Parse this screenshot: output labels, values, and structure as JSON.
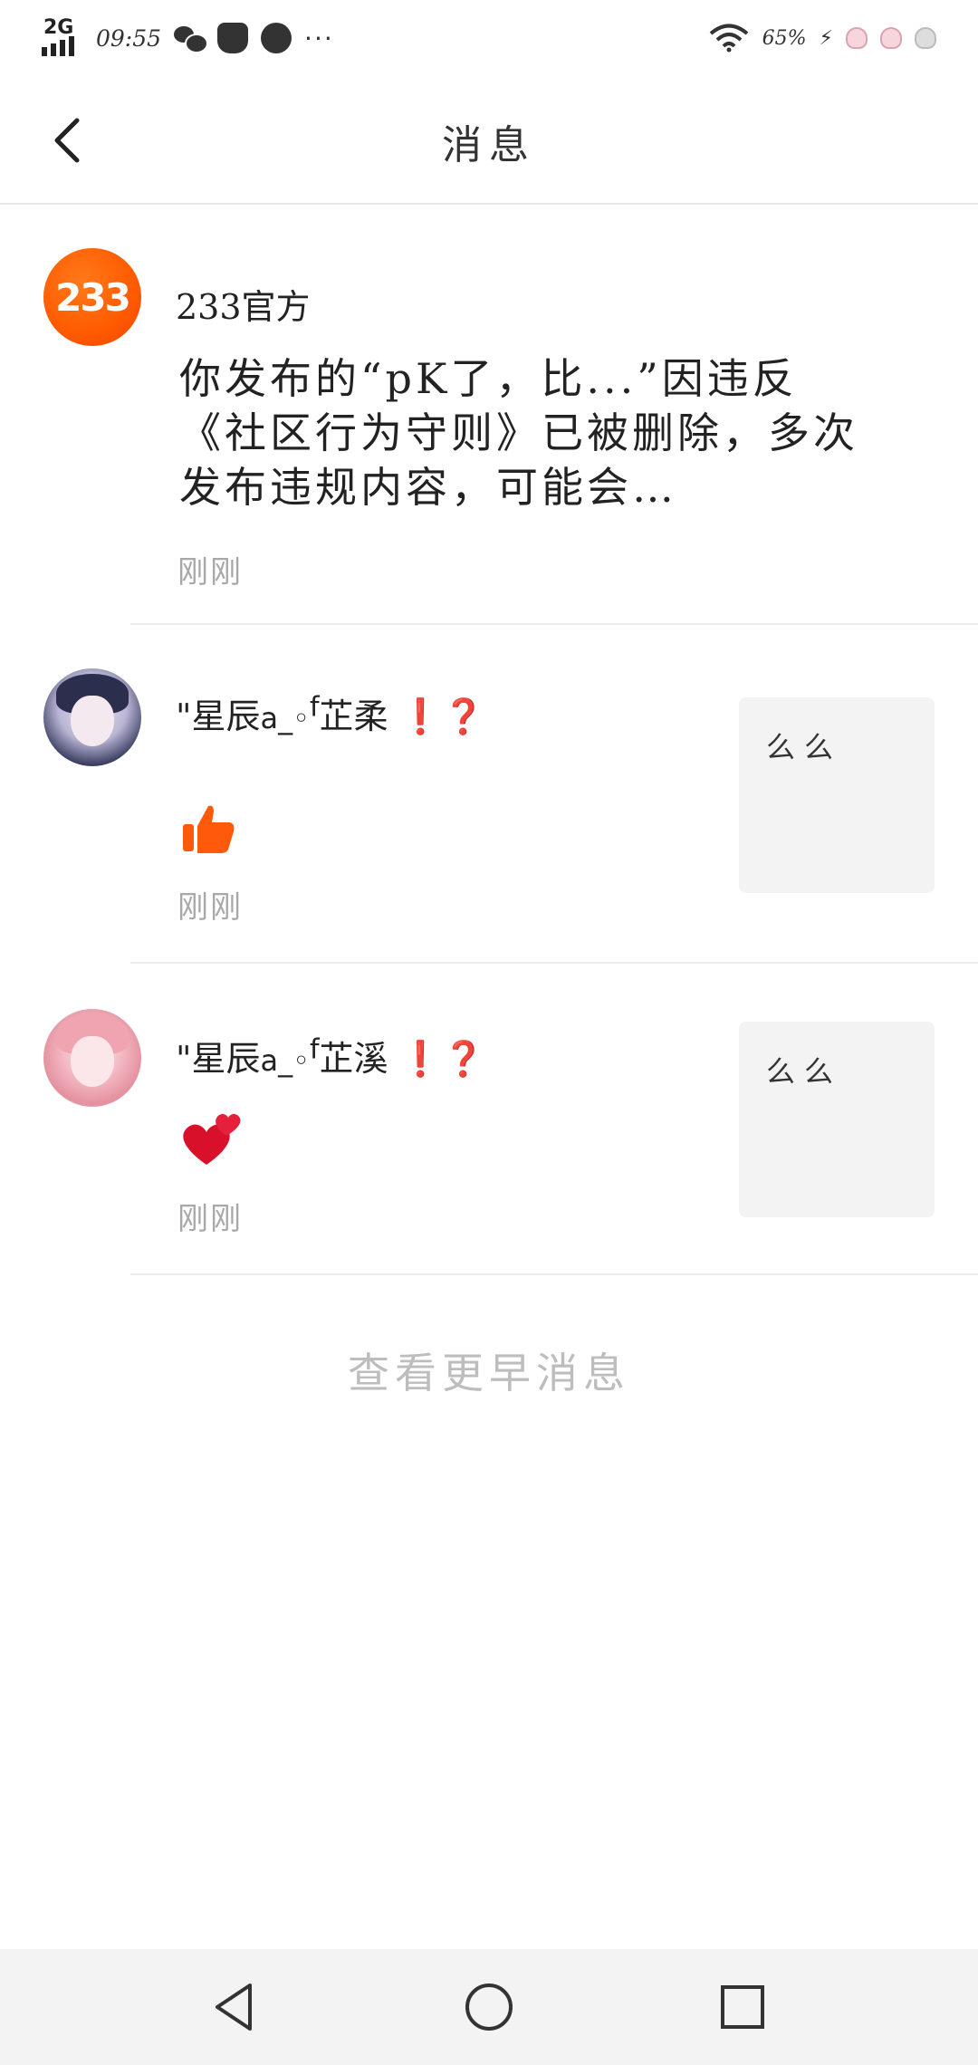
{
  "status_bar": {
    "network": "2G",
    "time": "09:55",
    "more": "···",
    "battery": "65%"
  },
  "header": {
    "title": "消息"
  },
  "messages": [
    {
      "sender": "233官方",
      "avatar_text": "233",
      "body": "你发布的“pK了，比...”因违反《社区行为守则》已被删除，多次发布违规内容，可能会…",
      "time": "刚刚"
    },
    {
      "sender_prefix": "\"星辰",
      "sender_mid": "a_◦",
      "sender_f": "f",
      "sender_name": "芷柔",
      "sender_emoji": "❗❓",
      "reaction": "thumbs-up",
      "time": "刚刚",
      "preview": "么么"
    },
    {
      "sender_prefix": "\"星辰",
      "sender_mid": "a_◦",
      "sender_f": "f",
      "sender_name": "芷溪",
      "sender_emoji": "❗❓",
      "reaction": "two-hearts",
      "time": "刚刚",
      "preview": "么么"
    }
  ],
  "more_link": "查看更早消息",
  "colors": {
    "official_orange": "#ff5a00",
    "accent_red": "#e0203a",
    "muted": "#a8a8a8"
  },
  "icons": [
    "back-arrow-icon",
    "wifi-icon",
    "thumbs-up-icon",
    "two-hearts-icon",
    "nav-back-icon",
    "nav-home-icon",
    "nav-recents-icon"
  ]
}
